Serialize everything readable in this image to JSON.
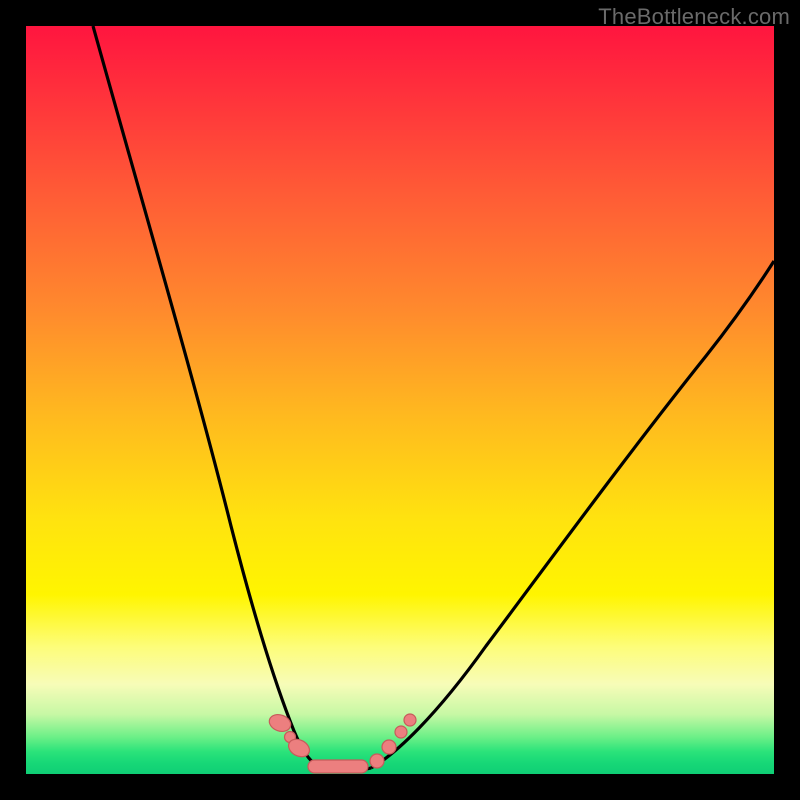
{
  "watermark": "TheBottleneck.com",
  "colors": {
    "frame": "#000000",
    "gradient_top": "#ff153f",
    "gradient_mid": "#ffe30f",
    "gradient_bottom": "#0fce75",
    "curve": "#000000",
    "marker_fill": "#ec7f7f",
    "marker_stroke": "#c75b5b"
  },
  "chart_data": {
    "type": "line",
    "title": "",
    "xlabel": "",
    "ylabel": "",
    "xlim": [
      0,
      100
    ],
    "ylim": [
      0,
      100
    ],
    "grid": false,
    "legend": false,
    "series": [
      {
        "name": "left-branch",
        "x": [
          9,
          15,
          20,
          25,
          28,
          30,
          32,
          34,
          36,
          37.5
        ],
        "y": [
          100,
          72,
          50,
          30,
          20,
          14,
          9,
          5,
          2.5,
          1.5
        ]
      },
      {
        "name": "valley",
        "x": [
          37.5,
          39,
          41,
          43,
          45,
          47
        ],
        "y": [
          1.5,
          0.8,
          0.5,
          0.5,
          0.9,
          1.6
        ]
      },
      {
        "name": "right-branch",
        "x": [
          47,
          52,
          58,
          66,
          76,
          88,
          100
        ],
        "y": [
          1.6,
          5,
          12,
          23,
          38,
          55,
          71
        ]
      }
    ],
    "markers": [
      {
        "name": "pill-left-upper",
        "shape": "pill",
        "x": 33.8,
        "y": 6.5
      },
      {
        "name": "pill-left-lower",
        "shape": "pill",
        "x": 36.2,
        "y": 3.0
      },
      {
        "name": "longpill-floor",
        "shape": "longpill",
        "x": 41.5,
        "y": 0.8
      },
      {
        "name": "dot-right-lower",
        "shape": "dot",
        "x": 47.5,
        "y": 2.6
      },
      {
        "name": "dot-right-mid",
        "shape": "dot",
        "x": 49.3,
        "y": 4.6
      },
      {
        "name": "dot-right-upper",
        "shape": "dot",
        "x": 51.0,
        "y": 6.8
      }
    ]
  }
}
